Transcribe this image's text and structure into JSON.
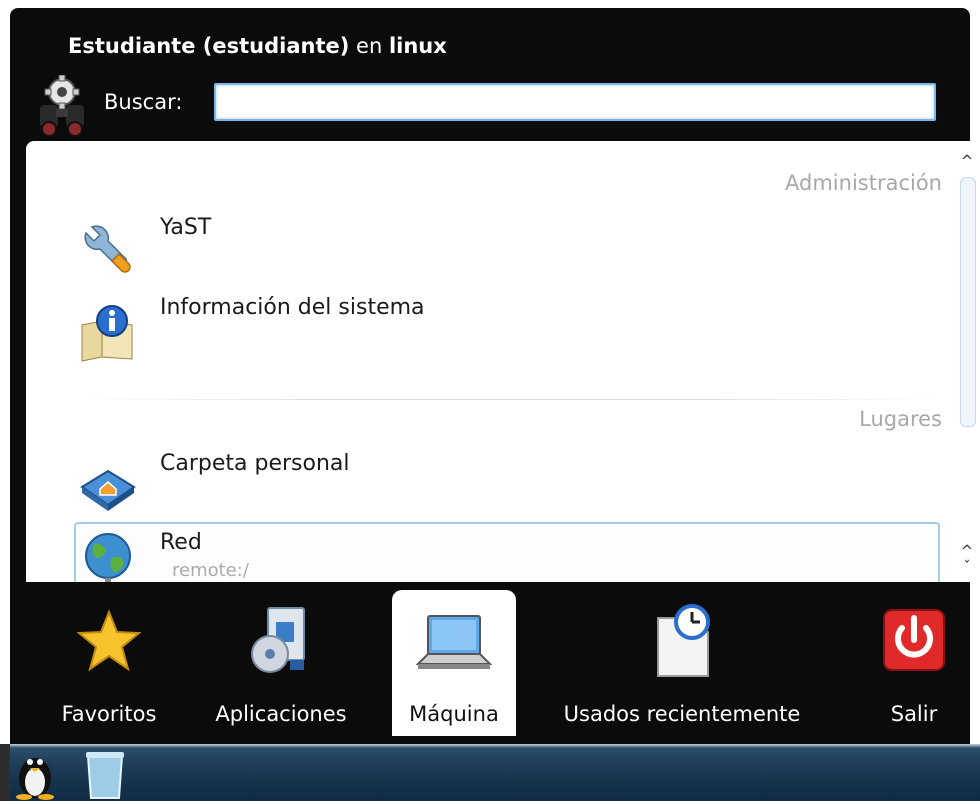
{
  "header": {
    "user_name": "Estudiante (estudiante)",
    "connector": " en ",
    "host": "linux"
  },
  "search": {
    "label": "Buscar:",
    "value": "",
    "placeholder": ""
  },
  "sections": [
    {
      "header": "Administración",
      "items": [
        {
          "label": "YaST",
          "icon": "yast-wrench-icon"
        },
        {
          "label": "Información del sistema",
          "icon": "system-info-icon"
        }
      ]
    },
    {
      "header": "Lugares",
      "items": [
        {
          "label": "Carpeta personal",
          "icon": "home-folder-icon"
        },
        {
          "label": "Red",
          "sublabel": "remote:/",
          "icon": "network-globe-icon"
        }
      ]
    }
  ],
  "tabs": [
    {
      "label": "Favoritos",
      "icon": "star-icon",
      "active": false
    },
    {
      "label": "Aplicaciones",
      "icon": "applications-icon",
      "active": false
    },
    {
      "label": "Máquina",
      "icon": "laptop-icon",
      "active": true
    },
    {
      "label": "Usados recientemente",
      "icon": "recent-document-clock-icon",
      "active": false
    },
    {
      "label": "Salir",
      "icon": "power-icon",
      "active": false
    }
  ],
  "colors": {
    "background": "#0b0b0b",
    "panel": "#ffffff",
    "section_header": "#a8a8a8",
    "selection_border": "#a8cbe8",
    "power_red": "#e02a2a",
    "taskbar": "#1e3d58"
  }
}
